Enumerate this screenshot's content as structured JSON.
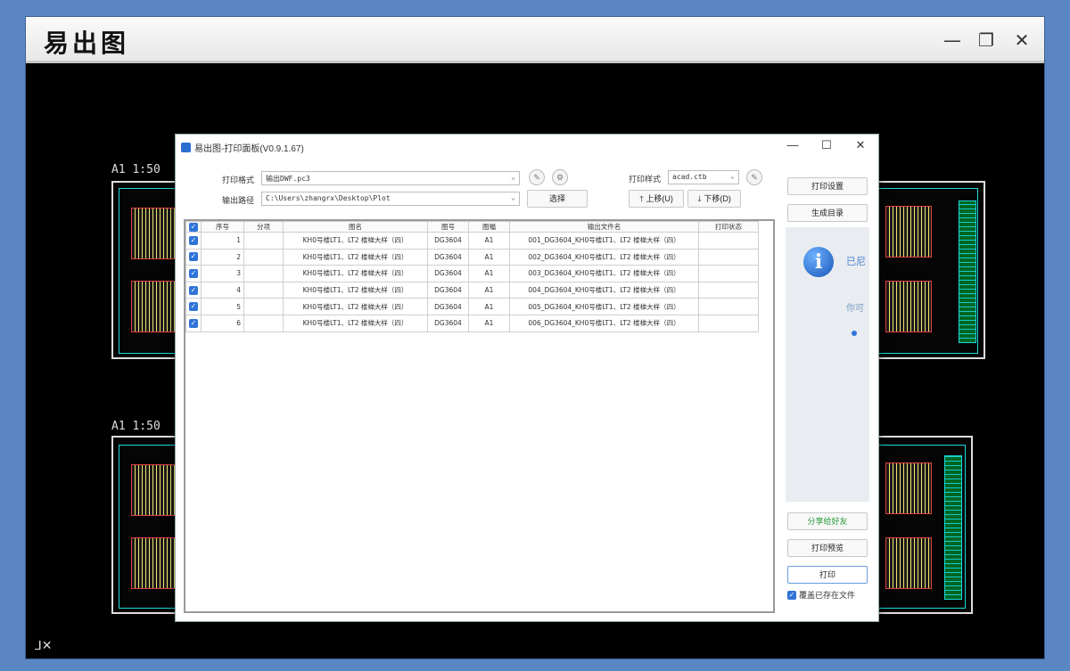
{
  "app": {
    "title": "易出图"
  },
  "window_controls": {
    "minimize": "—",
    "maximize": "❐",
    "close": "✕"
  },
  "canvas": {
    "sheet_labels": [
      "A1 1:50",
      "A1 1:50"
    ],
    "axis_mark": "⅃✕"
  },
  "dialog": {
    "title": "易出图-打印面板(V0.9.1.67)",
    "controls": {
      "minimize": "—",
      "maximize": "☐",
      "close": "✕"
    },
    "print_format": {
      "label": "打印格式",
      "value": "输出DWF.pc3"
    },
    "output_path": {
      "label": "输出路径",
      "value": "C:\\Users\\zhangrx\\Desktop\\Plot"
    },
    "select_button": "选择",
    "print_style": {
      "label": "打印样式",
      "value": "acad.ctb"
    },
    "move_up": "上移(U)",
    "move_down": "下移(D)",
    "table": {
      "headers": [
        "序号",
        "分项",
        "图名",
        "图号",
        "图幅",
        "输出文件名",
        "打印状态"
      ],
      "rows": [
        {
          "no": "1",
          "item": "",
          "name": "KH0号楼LT1、LT2 楼梯大样（四）",
          "code": "DG3604",
          "size": "A1",
          "file": "001_DG3604_KH0号楼LT1、LT2 楼梯大样（四）",
          "status": ""
        },
        {
          "no": "2",
          "item": "",
          "name": "KH0号楼LT1、LT2 楼梯大样（四）",
          "code": "DG3604",
          "size": "A1",
          "file": "002_DG3604_KH0号楼LT1、LT2 楼梯大样（四）",
          "status": ""
        },
        {
          "no": "3",
          "item": "",
          "name": "KH0号楼LT1、LT2 楼梯大样（四）",
          "code": "DG3604",
          "size": "A1",
          "file": "003_DG3604_KH0号楼LT1、LT2 楼梯大样（四）",
          "status": ""
        },
        {
          "no": "4",
          "item": "",
          "name": "KH0号楼LT1、LT2 楼梯大样（四）",
          "code": "DG3604",
          "size": "A1",
          "file": "004_DG3604_KH0号楼LT1、LT2 楼梯大样（四）",
          "status": ""
        },
        {
          "no": "5",
          "item": "",
          "name": "KH0号楼LT1、LT2 楼梯大样（四）",
          "code": "DG3604",
          "size": "A1",
          "file": "005_DG3604_KH0号楼LT1、LT2 楼梯大样（四）",
          "status": ""
        },
        {
          "no": "6",
          "item": "",
          "name": "KH0号楼LT1、LT2 楼梯大样（四）",
          "code": "DG3604",
          "size": "A1",
          "file": "006_DG3604_KH0号楼LT1、LT2 楼梯大样（四）",
          "status": ""
        }
      ]
    },
    "right": {
      "print_settings": "打印设置",
      "generate_catalog": "生成目录",
      "info_title": "已尼",
      "info_sub": "你可",
      "share_button": "分享给好友",
      "preview_button": "打印预览",
      "print_button": "打印",
      "overwrite_label": "覆盖已存在文件"
    }
  },
  "colors": {
    "accent": "#2f74d8",
    "cad_cyan": "#1bd9d9",
    "frame_blue": "#5b86c4"
  }
}
